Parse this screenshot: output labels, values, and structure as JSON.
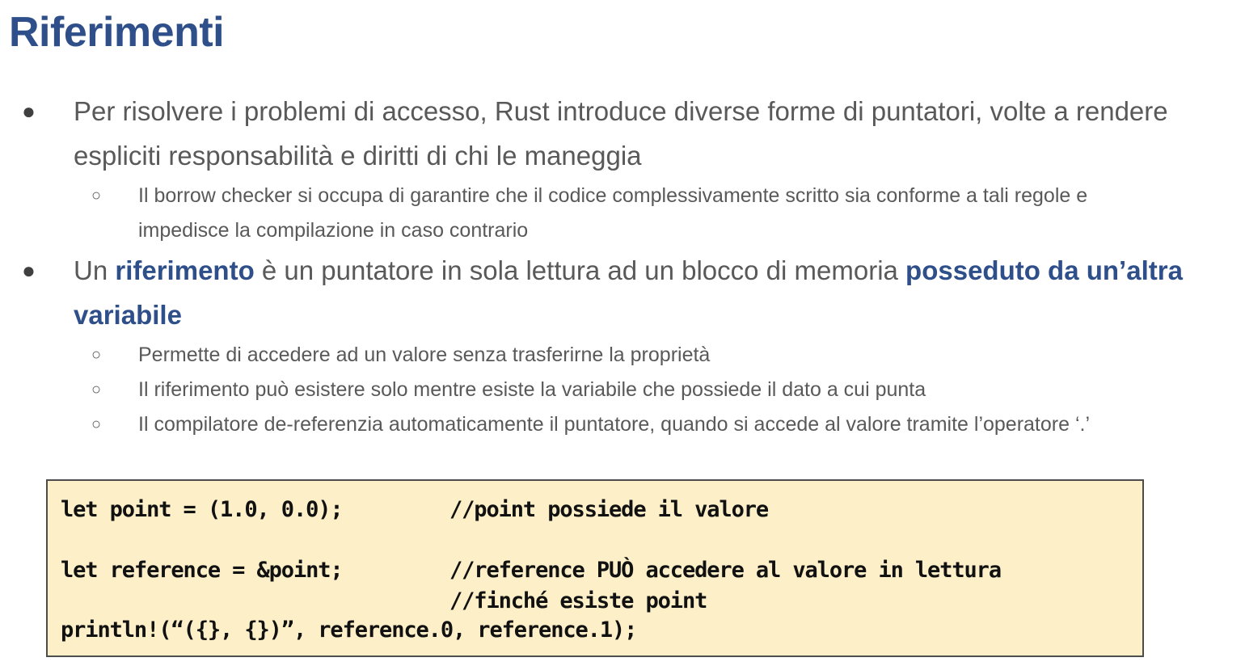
{
  "title": "Riferimenti",
  "bullets": [
    {
      "text": "Per risolvere i problemi di accesso, Rust introduce diverse forme di puntatori, volte a rendere espliciti responsabilità e diritti di chi le maneggia",
      "sub": [
        "Il borrow checker si occupa di garantire che il codice complessivamente scritto sia conforme a tali regole e impedisce la compilazione in caso contrario"
      ]
    },
    {
      "parts": {
        "p1": "Un ",
        "b1": "riferimento",
        "p2": " è un puntatore in sola lettura ad un blocco di memoria ",
        "b2": "posseduto da un’altra variabile"
      },
      "sub": [
        "Permette di accedere ad un valore senza trasferirne la proprietà",
        "Il riferimento può esistere solo mentre esiste la variabile che possiede il dato a cui punta",
        "Il compilatore de-referenzia automaticamente il puntatore, quando si accede al valore tramite l’operatore ‘.’"
      ]
    }
  ],
  "bullet_symbol": "●",
  "sub_bullet_symbol": "○",
  "code": {
    "line1": "let point = (1.0, 0.0);",
    "comment1": "//point possiede il valore",
    "line2": "let reference = &point;",
    "comment2": "//reference PUÒ accedere al valore in lettura",
    "comment3": "//finché esiste point",
    "line4": "println!(“({}, {})”, reference.0, reference.1);"
  },
  "colors": {
    "title": "#2e4f8a",
    "body_text": "#595959",
    "code_background": "#fdf0c8"
  }
}
